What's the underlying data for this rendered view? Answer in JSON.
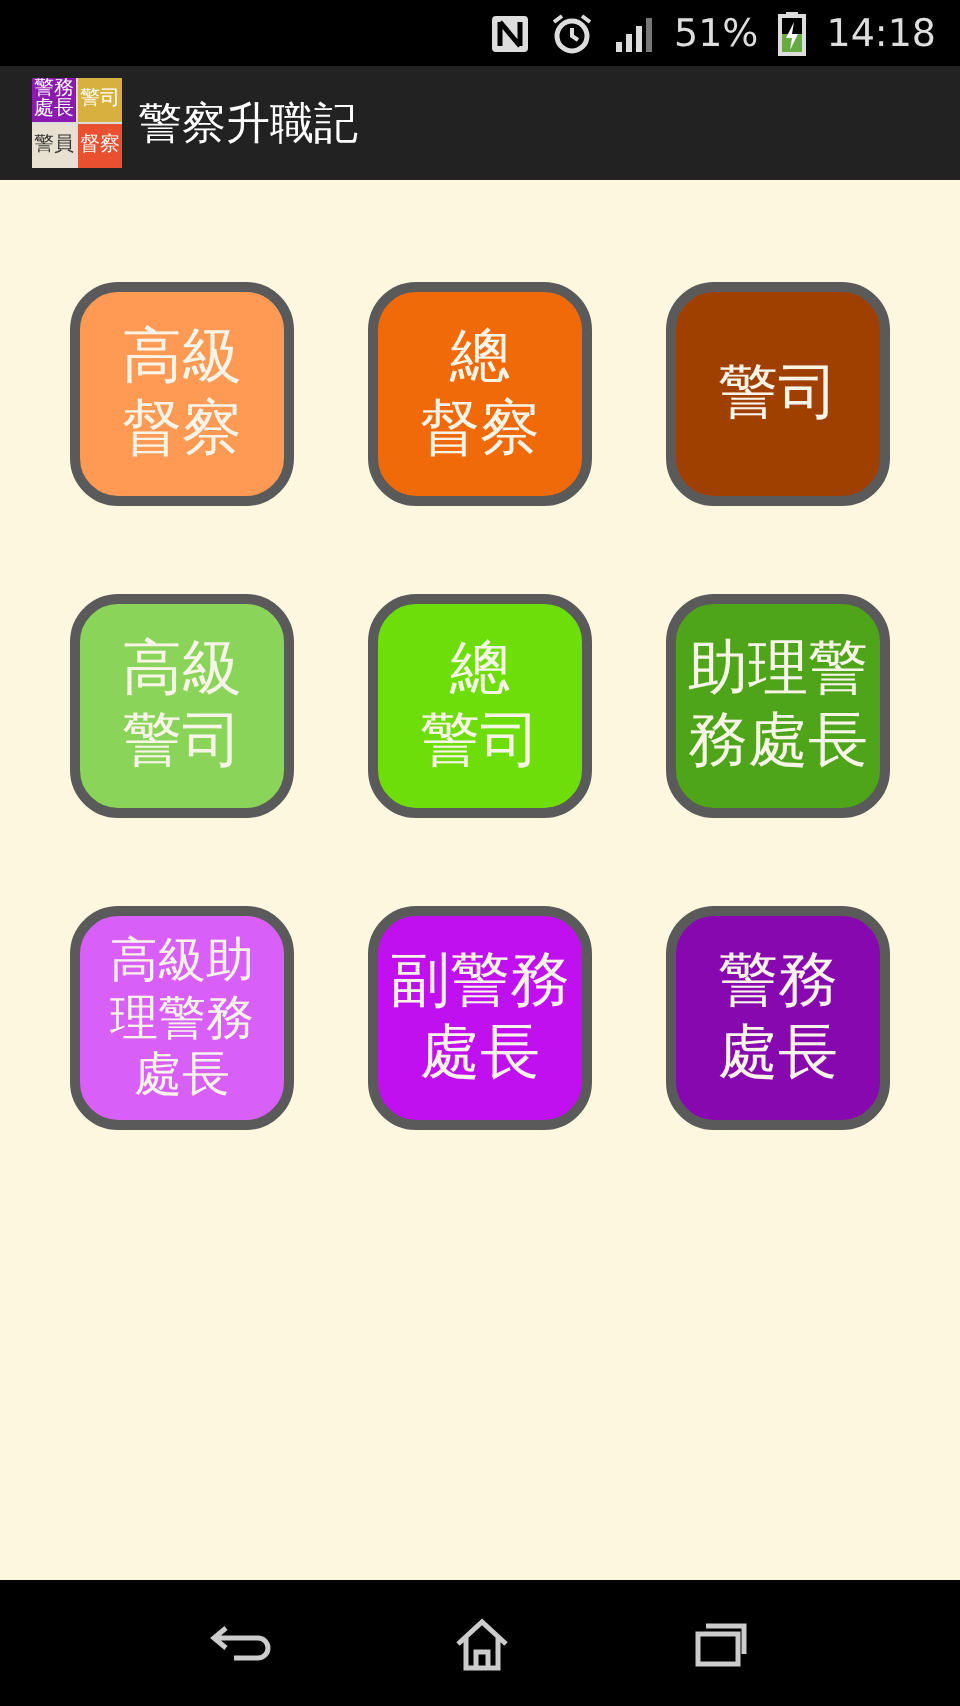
{
  "status_bar": {
    "battery": "51%",
    "time": "14:18"
  },
  "app_bar": {
    "title": "警察升職記",
    "logo": [
      {
        "text": "警務處長",
        "color": "#8a1ab0"
      },
      {
        "text": "警司",
        "color": "#d8b040"
      },
      {
        "text": "警員",
        "color": "#e8e0d0"
      },
      {
        "text": "督察",
        "color": "#e85030"
      }
    ]
  },
  "tiles": [
    {
      "lines": [
        "高級",
        "督察"
      ],
      "color": "#ff9a55"
    },
    {
      "lines": [
        "總",
        "督察"
      ],
      "color": "#f06a0a"
    },
    {
      "lines": [
        "警司"
      ],
      "color": "#a04000"
    },
    {
      "lines": [
        "高級",
        "警司"
      ],
      "color": "#8ad45a"
    },
    {
      "lines": [
        "總",
        "警司"
      ],
      "color": "#6ede0a"
    },
    {
      "lines": [
        "助理警",
        "務處長"
      ],
      "color": "#4fa51a"
    },
    {
      "lines": [
        "高級助",
        "理警務",
        "處長"
      ],
      "color": "#d860f8"
    },
    {
      "lines": [
        "副警務",
        "處長"
      ],
      "color": "#c010f0"
    },
    {
      "lines": [
        "警務",
        "處長"
      ],
      "color": "#8808b0"
    }
  ]
}
